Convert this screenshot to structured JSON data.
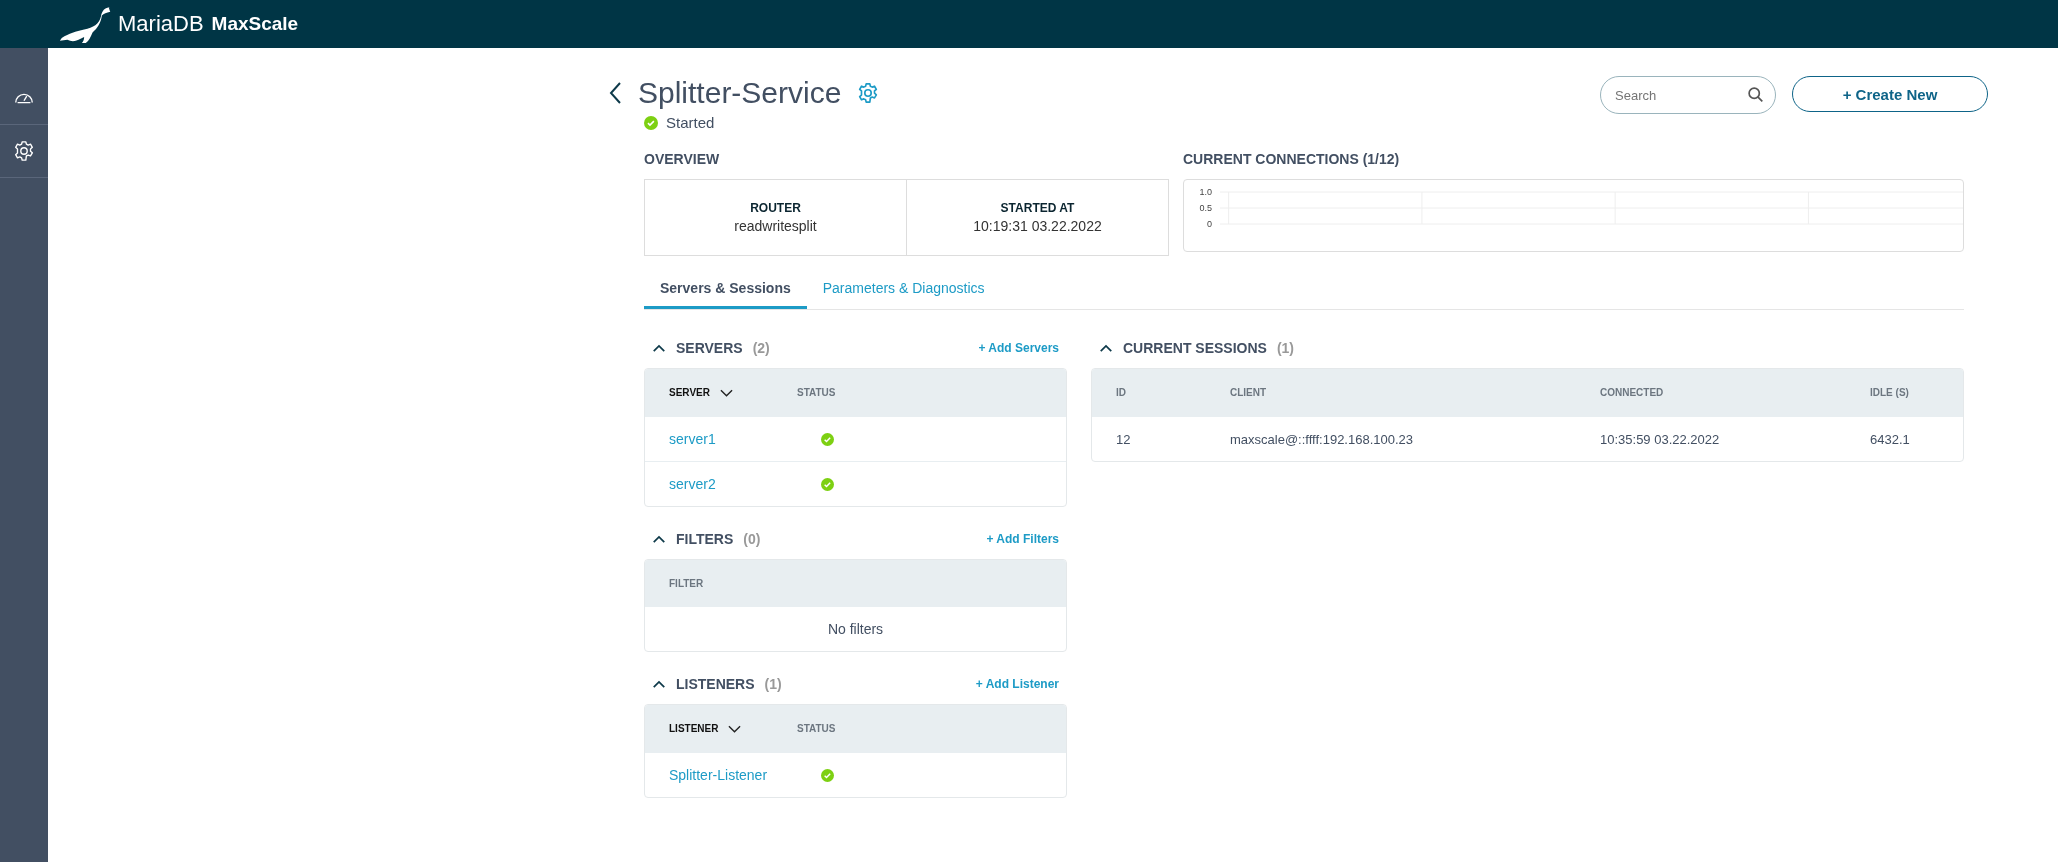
{
  "app": {
    "brand_main": "MariaDB",
    "brand_product": "MaxScale"
  },
  "sidebar": {
    "items": [
      {
        "kind": "dashboard"
      },
      {
        "kind": "settings"
      }
    ]
  },
  "page": {
    "title": "Splitter-Service",
    "status": "Started"
  },
  "search": {
    "placeholder": "Search"
  },
  "create_button": "+ Create New",
  "overview": {
    "title": "OVERVIEW",
    "items": [
      {
        "label": "ROUTER",
        "value": "readwritesplit"
      },
      {
        "label": "STARTED AT",
        "value": "10:19:31 03.22.2022"
      }
    ]
  },
  "connections": {
    "title": "CURRENT CONNECTIONS (1/12)",
    "y_labels": [
      "1.0",
      "0.5",
      "0"
    ]
  },
  "tabs": [
    {
      "label": "Servers & Sessions",
      "selected": true
    },
    {
      "label": "Parameters & Diagnostics",
      "selected": false
    }
  ],
  "sections": [
    {
      "title": "SERVERS",
      "count": "(2)",
      "action": "+ Add Servers",
      "columns": [
        {
          "label": "SERVER",
          "sortable": true
        },
        {
          "label": "STATUS",
          "sortable": false
        }
      ],
      "rows": [
        "server1",
        "server2"
      ]
    },
    {
      "title": "FILTERS",
      "count": "(0)",
      "action": "+ Add Filters",
      "columns": [
        {
          "label": "FILTER",
          "sortable": false
        }
      ],
      "empty": "No filters"
    },
    {
      "title": "LISTENERS",
      "count": "(1)",
      "action": "+ Add Listener",
      "columns": [
        {
          "label": "LISTENER",
          "sortable": true
        },
        {
          "label": "STATUS",
          "sortable": false
        }
      ],
      "rows": [
        "Splitter-Listener"
      ]
    }
  ],
  "sessions": {
    "title": "CURRENT SESSIONS",
    "count": "(1)",
    "columns": [
      "ID",
      "CLIENT",
      "CONNECTED",
      "IDLE (S)"
    ],
    "rows": [
      [
        "12",
        "maxscale@::ffff:192.168.100.23",
        "10:35:59 03.22.2022",
        "6432.1"
      ]
    ]
  }
}
